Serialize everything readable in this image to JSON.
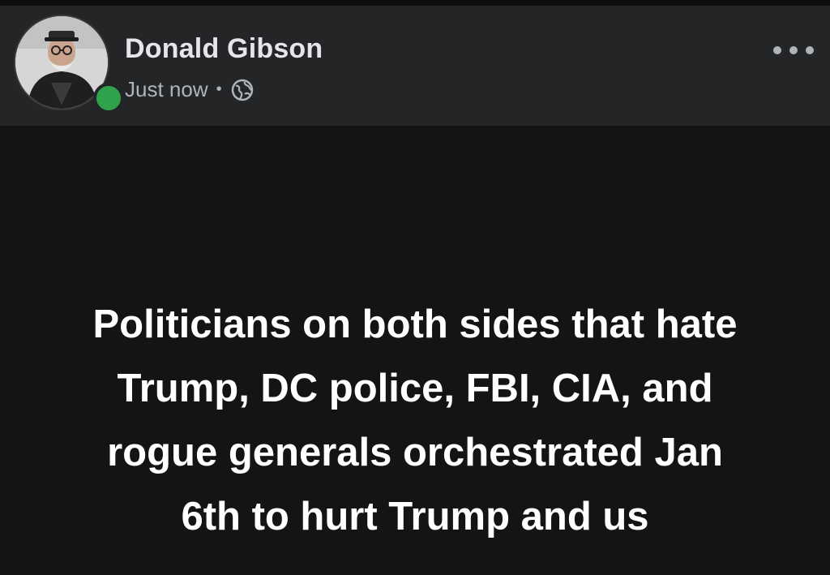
{
  "post": {
    "author_name": "Donald Gibson",
    "timestamp": "Just now",
    "separator": "•",
    "privacy_icon": "globe-icon",
    "more_icon": "more-options-icon",
    "text_lines": [
      "Politicians on both sides that hate",
      "Trump, DC police, FBI, CIA, and",
      "rogue generals orchestrated Jan",
      "6th to hurt Trump and us"
    ],
    "online_status_color": "#31a24c"
  }
}
